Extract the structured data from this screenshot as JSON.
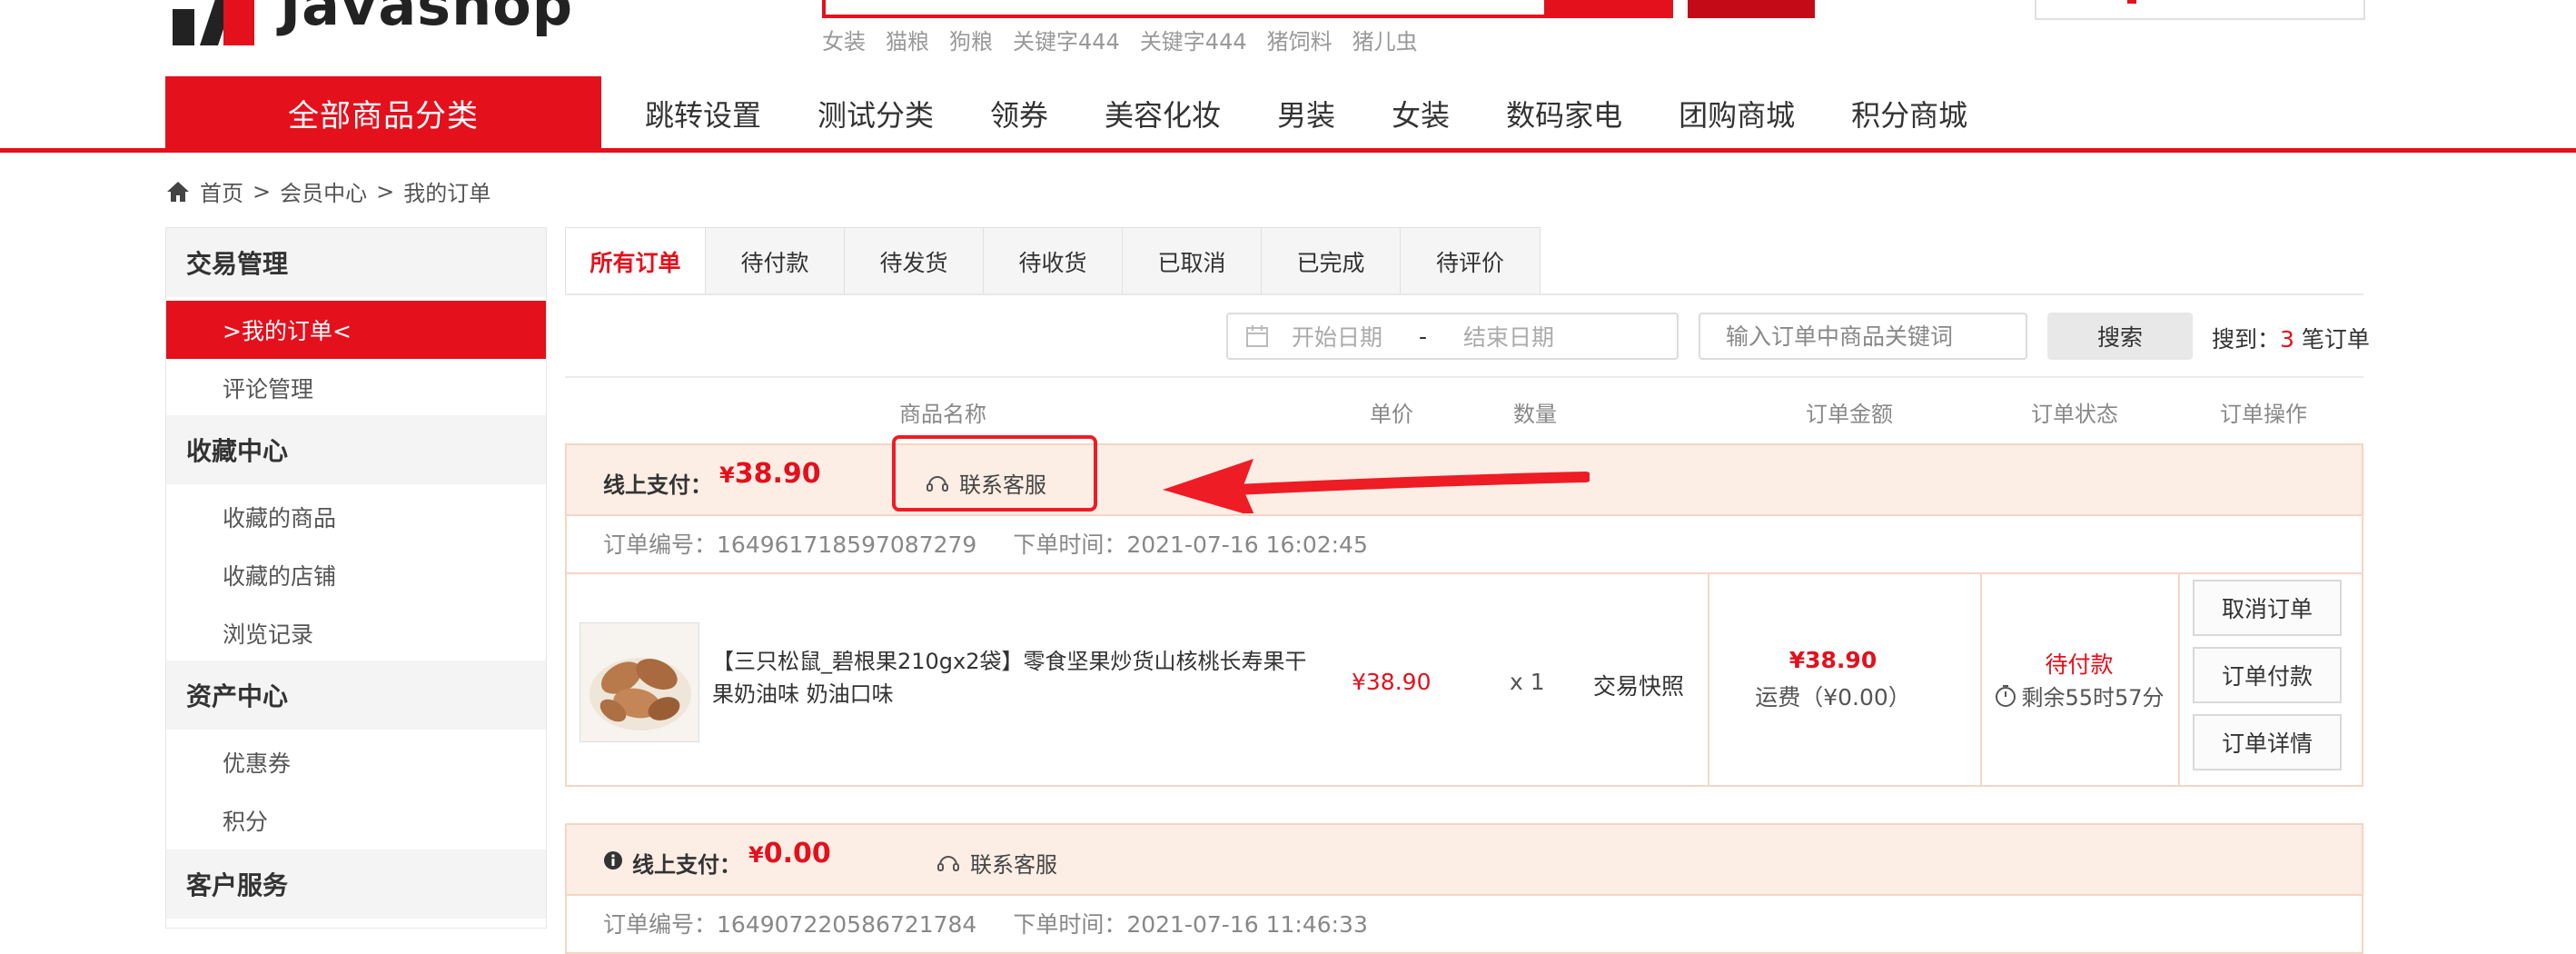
{
  "header": {
    "logo_text": "Javashop",
    "hot_words": [
      "女装",
      "猫粮",
      "狗粮",
      "关键字444",
      "关键字444",
      "猪饲料",
      "猪儿虫"
    ]
  },
  "nav": {
    "all_categories": "全部商品分类",
    "items": [
      "跳转设置",
      "测试分类",
      "领券",
      "美容化妆",
      "男装",
      "女装",
      "数码家电",
      "团购商城",
      "积分商城"
    ]
  },
  "breadcrumb": [
    "首页",
    ">",
    "会员中心",
    ">",
    "我的订单"
  ],
  "sidebar": {
    "sections": [
      {
        "title": "交易管理",
        "items": [
          ">我的订单<",
          "评论管理"
        ]
      },
      {
        "title": "收藏中心",
        "items": [
          "收藏的商品",
          "收藏的店铺",
          "浏览记录"
        ]
      },
      {
        "title": "资产中心",
        "items": [
          "优惠券",
          "积分"
        ]
      },
      {
        "title": "客户服务",
        "items": []
      }
    ]
  },
  "tabs": [
    "所有订单",
    "待付款",
    "待发货",
    "待收货",
    "已取消",
    "已完成",
    "待评价"
  ],
  "filter": {
    "start_date": "开始日期",
    "date_sep": "-",
    "end_date": "结束日期",
    "keyword_placeholder": "输入订单中商品关键词",
    "search_label": "搜索",
    "result_prefix": "搜到：",
    "result_count": "3",
    "result_suffix": "笔订单"
  },
  "columns": [
    "商品名称",
    "单价",
    "数量",
    "订单金额",
    "订单状态",
    "订单操作"
  ],
  "orders": [
    {
      "pay_label": "线上支付：",
      "currency": "¥",
      "pay_amount": "38.90",
      "contact": "联系客服",
      "order_no_label": "订单编号：",
      "order_no": "164961718597087279",
      "time_label": "下单时间：",
      "time": "2021-07-16 16:02:45",
      "product_name": "【三只松鼠_碧根果210gx2袋】零食坚果炒货山核桃长寿果干果奶油味 奶油口味",
      "unit_price": "¥38.90",
      "quantity": "x 1",
      "snapshot": "交易快照",
      "total": "¥38.90",
      "freight": "运费（¥0.00）",
      "status": "待付款",
      "remaining": "剩余55时57分",
      "actions": [
        "取消订单",
        "订单付款",
        "订单详情"
      ]
    },
    {
      "pay_label": "线上支付：",
      "currency": "¥",
      "pay_amount": "0.00",
      "contact": "联系客服",
      "order_no_label": "订单编号：",
      "order_no": "164907220586721784",
      "time_label": "下单时间：",
      "time": "2021-07-16 11:46:33"
    }
  ],
  "colors": {
    "brand_red": "#e4101c",
    "order_head_bg": "#fdeee5",
    "annotation_red": "#ee1c25"
  }
}
